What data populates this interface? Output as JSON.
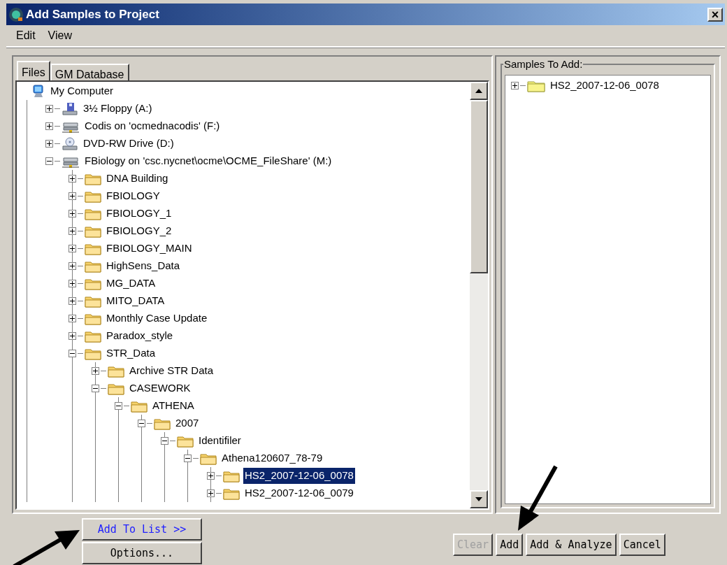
{
  "window": {
    "title": "Add Samples to Project",
    "close": "×"
  },
  "menu": [
    "Edit",
    "View"
  ],
  "tabs": [
    {
      "label": "Files",
      "selected": true
    },
    {
      "label": "GM Database",
      "selected": false
    }
  ],
  "tree": [
    {
      "label": "My Computer",
      "kind": "computer",
      "selected": false,
      "children": [
        {
          "label": "3½ Floppy (A:)",
          "kind": "floppy",
          "expanded": false,
          "selected": false
        },
        {
          "label": "Codis on 'ocmednacodis' (F:)",
          "kind": "network",
          "expanded": false,
          "selected": false
        },
        {
          "label": "DVD-RW Drive (D:)",
          "kind": "dvd",
          "expanded": false,
          "selected": false
        },
        {
          "label": "FBiology on 'csc.nycnet\\ocme\\OCME_FileShare' (M:)",
          "kind": "network",
          "expanded": true,
          "selected": false,
          "children": [
            {
              "label": "DNA Building",
              "kind": "folder",
              "expanded": false,
              "selected": false
            },
            {
              "label": "FBIOLOGY",
              "kind": "folder",
              "expanded": false,
              "selected": false
            },
            {
              "label": "FBIOLOGY_1",
              "kind": "folder",
              "expanded": false,
              "selected": false
            },
            {
              "label": "FBIOLOGY_2",
              "kind": "folder",
              "expanded": false,
              "selected": false
            },
            {
              "label": "FBIOLOGY_MAIN",
              "kind": "folder",
              "expanded": false,
              "selected": false
            },
            {
              "label": "HighSens_Data",
              "kind": "folder",
              "expanded": false,
              "selected": false
            },
            {
              "label": "MG_DATA",
              "kind": "folder",
              "expanded": false,
              "selected": false
            },
            {
              "label": "MITO_DATA",
              "kind": "folder",
              "expanded": false,
              "selected": false
            },
            {
              "label": "Monthly Case Update",
              "kind": "folder",
              "expanded": false,
              "selected": false
            },
            {
              "label": "Paradox_style",
              "kind": "folder",
              "expanded": false,
              "selected": false
            },
            {
              "label": "STR_Data",
              "kind": "folder",
              "expanded": true,
              "selected": false,
              "children": [
                {
                  "label": "Archive STR Data",
                  "kind": "folder",
                  "expanded": false,
                  "selected": false
                },
                {
                  "label": "CASEWORK",
                  "kind": "folder",
                  "expanded": true,
                  "selected": false,
                  "children": [
                    {
                      "label": "ATHENA",
                      "kind": "folder",
                      "expanded": true,
                      "selected": false,
                      "children": [
                        {
                          "label": "2007",
                          "kind": "folder",
                          "expanded": true,
                          "selected": false,
                          "children": [
                            {
                              "label": "Identifiler",
                              "kind": "folder",
                              "expanded": true,
                              "selected": false,
                              "children": [
                                {
                                  "label": "Athena120607_78-79",
                                  "kind": "folder",
                                  "expanded": true,
                                  "selected": false,
                                  "children": [
                                    {
                                      "label": "HS2_2007-12-06_0078",
                                      "kind": "folder",
                                      "expanded": false,
                                      "selected": true
                                    },
                                    {
                                      "label": "HS2_2007-12-06_0079",
                                      "kind": "folder",
                                      "expanded": false,
                                      "selected": false
                                    }
                                  ]
                                }
                              ]
                            }
                          ]
                        }
                      ]
                    }
                  ]
                }
              ]
            }
          ]
        }
      ]
    }
  ],
  "left_buttons": [
    {
      "label": "Add To List >>",
      "disabled": false,
      "primary": true
    },
    {
      "label": "Options...",
      "disabled": false,
      "primary": false
    }
  ],
  "samples": {
    "title": "Samples To Add:",
    "items": [
      {
        "label": "HS2_2007-12-06_0078",
        "kind": "sample",
        "expanded": false,
        "selected": false
      }
    ]
  },
  "buttons": [
    {
      "label": "Clear",
      "disabled": true
    },
    {
      "label": "Add",
      "disabled": false
    },
    {
      "label": "Add & Analyze",
      "disabled": false
    },
    {
      "label": "Cancel",
      "disabled": false
    }
  ]
}
